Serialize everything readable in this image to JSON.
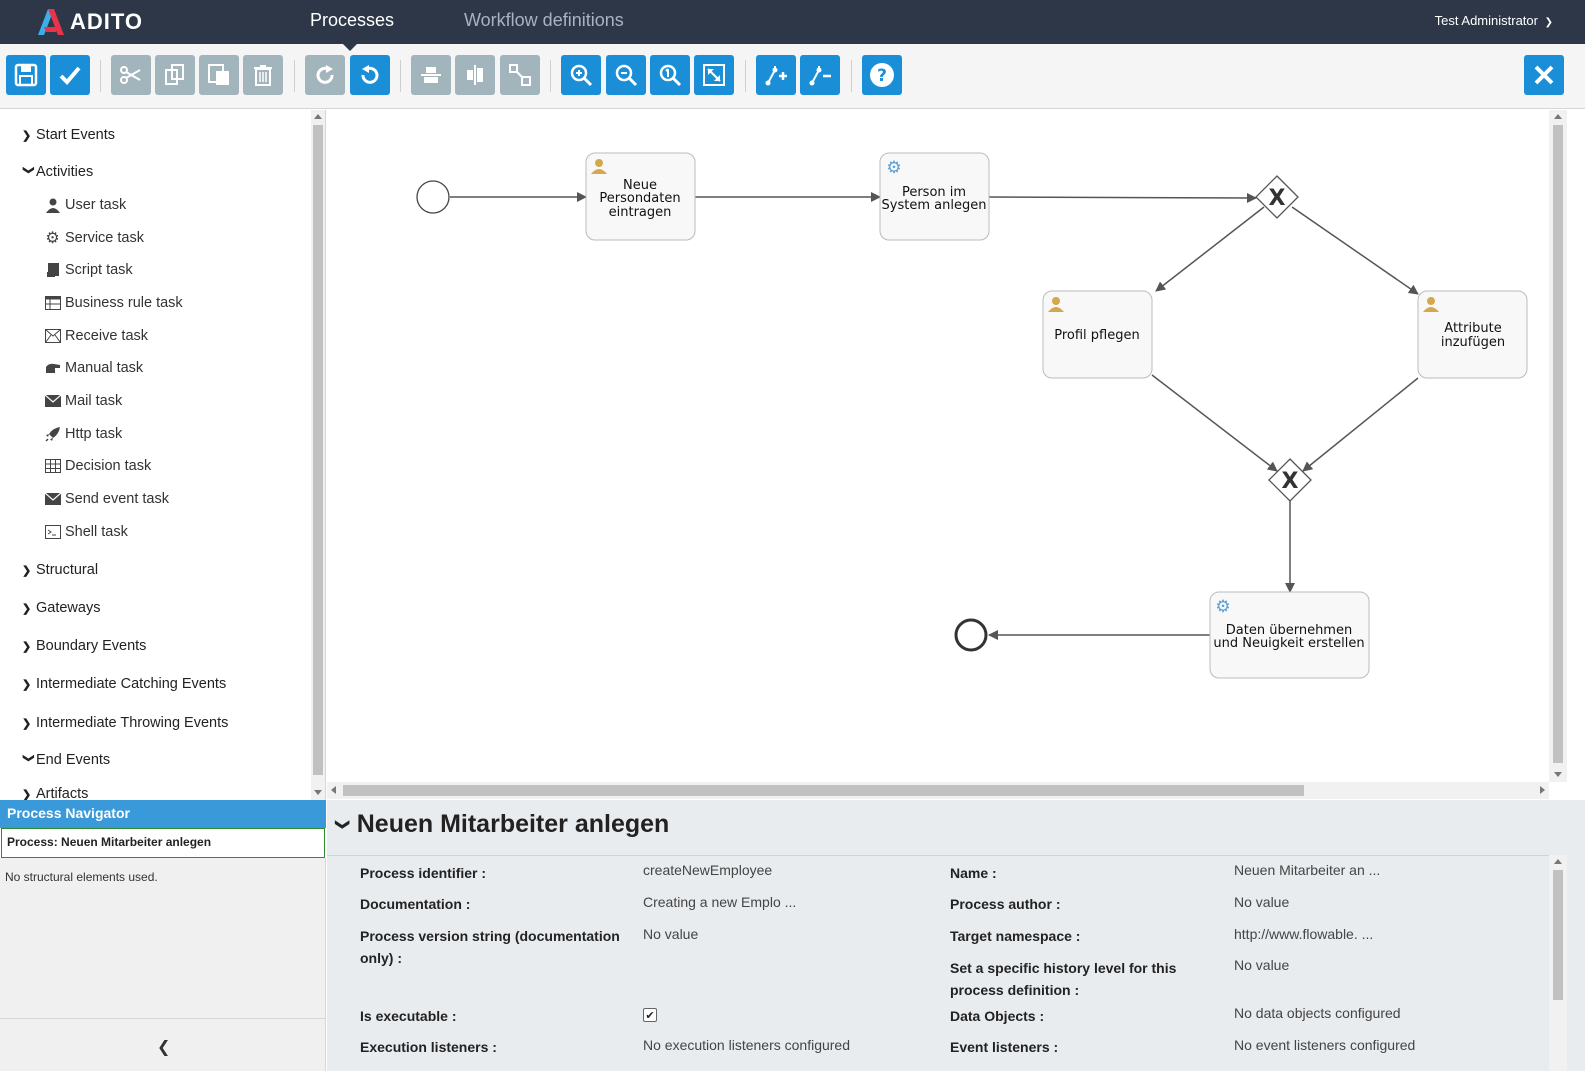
{
  "app": {
    "logo_text": "ADITO",
    "nav_tabs": [
      {
        "label": "Processes",
        "active": true
      },
      {
        "label": "Workflow definitions",
        "active": false
      }
    ],
    "user": "Test Administrator"
  },
  "toolbar": {
    "buttons": [
      {
        "name": "save-button",
        "icon": "floppy-disk-icon",
        "enabled": true
      },
      {
        "name": "validate-button",
        "icon": "checkmark-icon",
        "enabled": true
      },
      {
        "name": "cut-button",
        "icon": "scissors-icon",
        "enabled": false
      },
      {
        "name": "copy-button",
        "icon": "copy-icon",
        "enabled": false
      },
      {
        "name": "paste-button",
        "icon": "paste-icon",
        "enabled": false
      },
      {
        "name": "delete-button",
        "icon": "trash-icon",
        "enabled": false
      },
      {
        "name": "redo-button",
        "icon": "redo-icon",
        "enabled": false
      },
      {
        "name": "undo-button",
        "icon": "undo-icon",
        "enabled": true
      },
      {
        "name": "align-vertical-button",
        "icon": "align-vertical-icon",
        "enabled": false
      },
      {
        "name": "align-horizontal-button",
        "icon": "align-horizontal-icon",
        "enabled": false
      },
      {
        "name": "same-size-button",
        "icon": "same-size-icon",
        "enabled": false
      },
      {
        "name": "zoom-in-button",
        "icon": "zoom-in-icon",
        "enabled": true
      },
      {
        "name": "zoom-out-button",
        "icon": "zoom-out-icon",
        "enabled": true
      },
      {
        "name": "zoom-actual-button",
        "icon": "zoom-actual-icon",
        "enabled": true
      },
      {
        "name": "zoom-fit-button",
        "icon": "zoom-fit-icon",
        "enabled": true
      },
      {
        "name": "add-bendpoint-button",
        "icon": "add-bendpoint-icon",
        "enabled": true
      },
      {
        "name": "remove-bendpoint-button",
        "icon": "remove-bendpoint-icon",
        "enabled": true
      },
      {
        "name": "help-button",
        "icon": "question-icon",
        "enabled": true
      },
      {
        "name": "close-editor-button",
        "icon": "close-icon",
        "enabled": true
      }
    ]
  },
  "palette": {
    "groups": [
      {
        "label": "Start Events",
        "expanded": false
      },
      {
        "label": "Activities",
        "expanded": true
      },
      {
        "label": "Structural",
        "expanded": false
      },
      {
        "label": "Gateways",
        "expanded": false
      },
      {
        "label": "Boundary Events",
        "expanded": false
      },
      {
        "label": "Intermediate Catching Events",
        "expanded": false
      },
      {
        "label": "Intermediate Throwing Events",
        "expanded": false
      },
      {
        "label": "End Events",
        "expanded": true
      },
      {
        "label": "Artifacts",
        "expanded": false
      }
    ],
    "activities": [
      {
        "label": "User task",
        "icon": "user-icon"
      },
      {
        "label": "Service task",
        "icon": "gear-icon"
      },
      {
        "label": "Script task",
        "icon": "script-icon"
      },
      {
        "label": "Business rule task",
        "icon": "table-icon"
      },
      {
        "label": "Receive task",
        "icon": "envelope-icon"
      },
      {
        "label": "Manual task",
        "icon": "hand-icon"
      },
      {
        "label": "Mail task",
        "icon": "mail-icon"
      },
      {
        "label": "Http task",
        "icon": "rocket-icon"
      },
      {
        "label": "Decision task",
        "icon": "grid-icon"
      },
      {
        "label": "Send event task",
        "icon": "send-envelope-icon"
      },
      {
        "label": "Shell task",
        "icon": "terminal-icon"
      }
    ]
  },
  "navigator": {
    "title": "Process Navigator",
    "process": "Process: Neuen Mitarbeiter anlegen",
    "empty_text": "No structural elements used."
  },
  "diagram": {
    "tasks": [
      {
        "id": "t1",
        "lines": [
          "Neue",
          "Persondaten",
          "eintragen"
        ],
        "type": "user"
      },
      {
        "id": "t2",
        "lines": [
          "Person im",
          "System anlegen"
        ],
        "type": "service"
      },
      {
        "id": "t3",
        "lines": [
          "Profil pflegen"
        ],
        "type": "user"
      },
      {
        "id": "t4",
        "lines": [
          "Attribute",
          "inzufügen"
        ],
        "type": "user"
      },
      {
        "id": "t5",
        "lines": [
          "Daten übernehmen",
          "und Neuigkeit erstellen"
        ],
        "type": "service"
      }
    ],
    "gateway_symbol": "X",
    "colors": {
      "user_icon": "#d4a84e",
      "service_icon": "#5aa0d8",
      "flow": "#555555"
    }
  },
  "properties": {
    "title": "Neuen Mitarbeiter anlegen",
    "left": [
      {
        "label": "Process identifier :",
        "value": "createNewEmployee"
      },
      {
        "label": "Documentation :",
        "value": "Creating a new Emplo ..."
      },
      {
        "label": "Process version string (documentation only) :",
        "value": "No value"
      },
      {
        "label": "Is executable :",
        "value": "",
        "checkbox": true
      },
      {
        "label": "Execution listeners :",
        "value": "No execution listeners configured"
      }
    ],
    "right": [
      {
        "label": "Name :",
        "value": "Neuen Mitarbeiter an ..."
      },
      {
        "label": "Process author :",
        "value": "No value"
      },
      {
        "label": "Target namespace :",
        "value": "http://www.flowable. ..."
      },
      {
        "label": "Set a specific history level for this process definition :",
        "value": "No value"
      },
      {
        "label": "Data Objects :",
        "value": "No data objects configured"
      },
      {
        "label": "Event listeners :",
        "value": "No event listeners configured"
      }
    ]
  },
  "colors": {
    "topbar": "#2d3748",
    "accent": "#1a8fd8",
    "disabled": "#a3b5bc",
    "navigator_header": "#3a9ad9"
  }
}
